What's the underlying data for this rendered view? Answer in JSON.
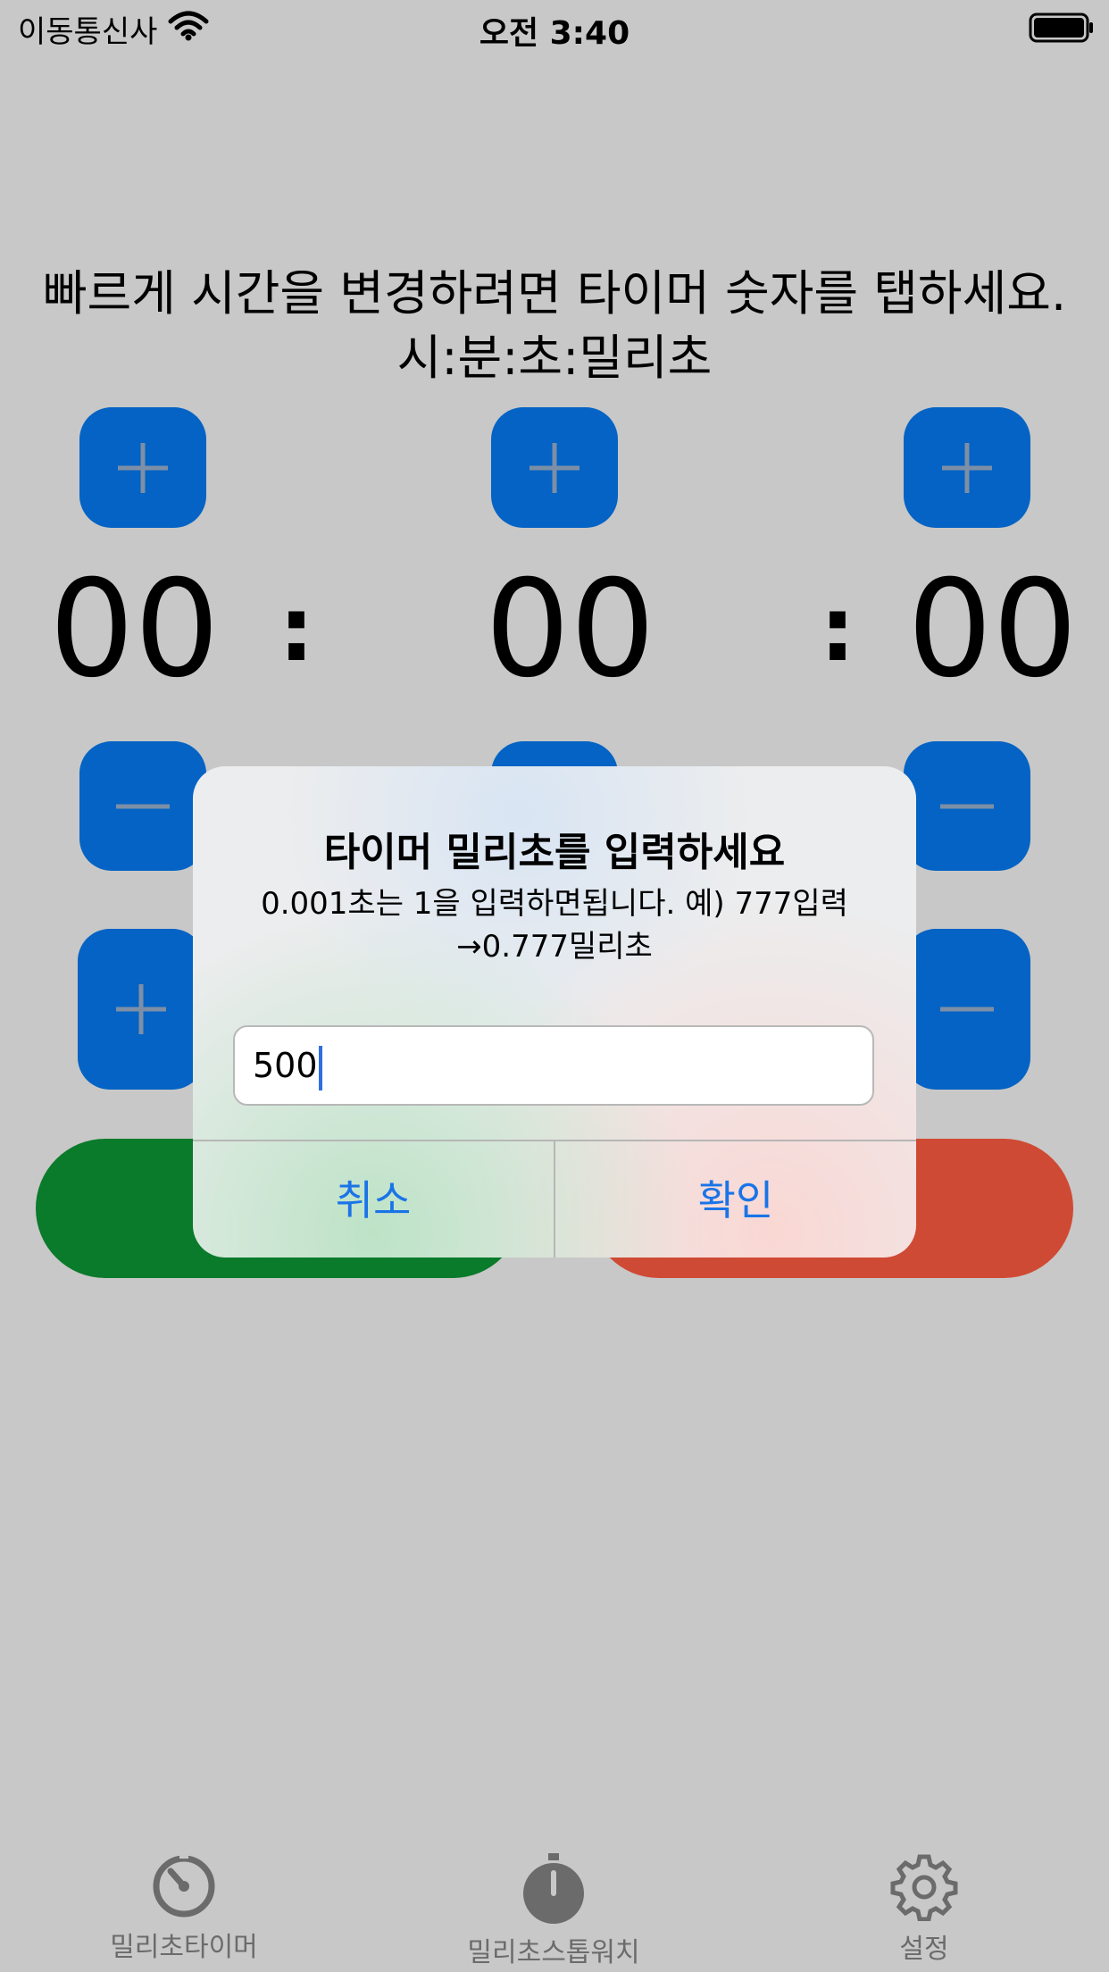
{
  "status_bar": {
    "carrier": "이동통신사",
    "time": "오전 3:40",
    "wifi_icon": "wifi-icon",
    "battery_icon": "battery-icon"
  },
  "instructions": {
    "line1": "빠르게 시간을 변경하려면 타이머 숫자를 탭하세요.",
    "line2": "시:분:초:밀리초"
  },
  "timer": {
    "minutes": "00",
    "seconds": "00",
    "milliseconds": "00",
    "separator": ":"
  },
  "dialog": {
    "title": "타이머 밀리초를 입력하세요",
    "message_line1": "0.001초는 1을 입력하면됩니다. 예) 777입력",
    "message_line2": "→0.777밀리초",
    "input_value": "500",
    "cancel_label": "취소",
    "ok_label": "확인"
  },
  "tab_bar": {
    "items": [
      {
        "label": "밀리초타이머",
        "icon": "timer-icon"
      },
      {
        "label": "밀리초스톱워치",
        "icon": "stopwatch-icon"
      },
      {
        "label": "설정",
        "icon": "gear-icon"
      }
    ]
  },
  "colors": {
    "background": "#c8c8c8",
    "stepper_blue": "#0463c4",
    "start_green": "#0a7a2b",
    "reset_red": "#cf4a34",
    "dialog_action_blue": "#1a74e8"
  }
}
